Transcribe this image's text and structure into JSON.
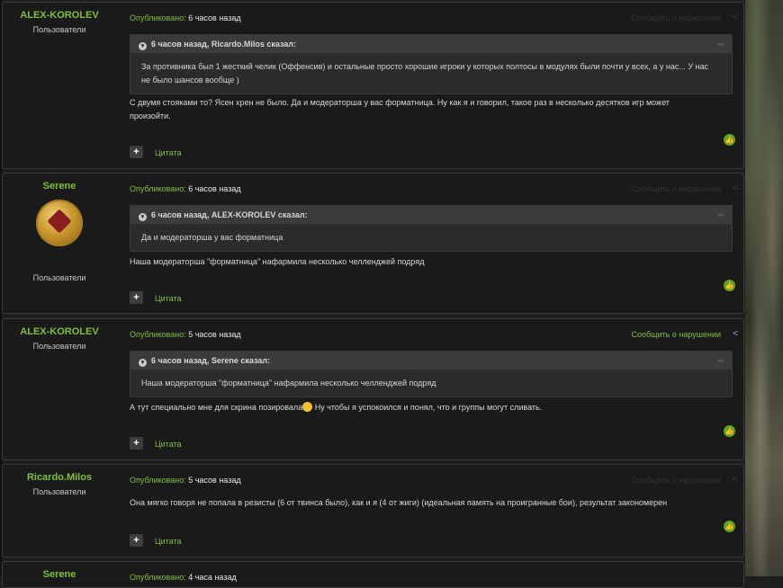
{
  "published_label": "Опубликовано:",
  "report_label": "Сообщить о нарушении",
  "cite_label": "Цитата",
  "icons": {
    "share": "share-icon",
    "plus": "plus-icon",
    "like": "thumbs-up-icon",
    "toggle": "chevron-down-icon"
  },
  "colors": {
    "accent": "#7ec03a",
    "background": "#1a1a1a",
    "quote_header": "#3b3b3b"
  },
  "posts": [
    {
      "author": "ALEX-KOROLEV",
      "group": "Пользователи",
      "time": "6 часов назад",
      "quote_author": "6 часов назад, Ricardo.Milos сказал:",
      "quote_text": "За противника был 1 жесткий челик (Оффенсив) и остальные просто хорошие игроки у которых полтосы в модулях были почти у всех, а у нас... У нас не было шансов вообще )",
      "text": "С двумя стояками то? Ясен хрен не было. Да и модераторша у вас форматница. Ну как я и говорил, такое раз в несколько десятков игр может произойти."
    },
    {
      "author": "Serene",
      "group": "Пользователи",
      "time": "6 часов назад",
      "quote_author": "6 часов назад, ALEX-KOROLEV сказал:",
      "quote_text": "Да и модераторша у вас форматница",
      "text": "Наша модераторша \"форматница\" нафармила несколько челленджей подряд"
    },
    {
      "author": "ALEX-KOROLEV",
      "group": "Пользователи",
      "time": "5 часов назад",
      "quote_author": "6 часов назад, Serene сказал:",
      "quote_text": "Наша модераторша \"форматница\" нафармила несколько челленджей подряд",
      "text_a": "А тут специально мне для скрина позировала",
      "text_b": " Ну чтобы я успокоился и понял, что и группы могут сливать."
    },
    {
      "author": "Ricardo.Milos",
      "group": "Пользователи",
      "time": "5 часов назад",
      "text": "Она мягко говоря не попала в резисты (6 от твинса было), как и я (4 от жиги) (идеальная память на проигранные бои), результат закономерен"
    },
    {
      "author": "Serene",
      "time": "4 часа назад"
    }
  ]
}
